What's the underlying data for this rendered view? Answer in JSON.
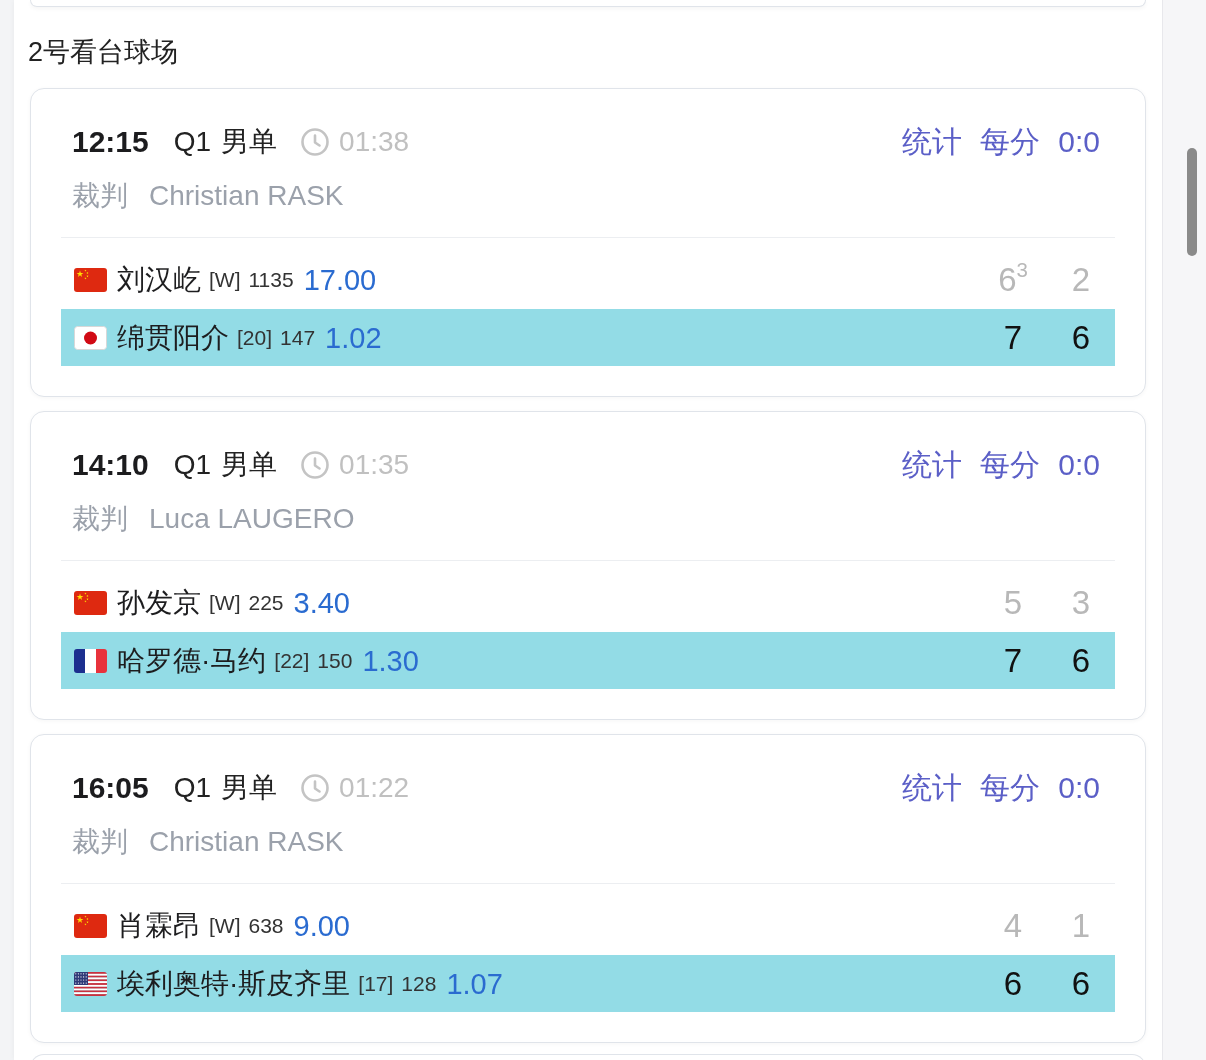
{
  "section": {
    "title": "2号看台球场"
  },
  "matches": [
    {
      "time": "12:15",
      "round": "Q1",
      "event": "男单",
      "duration": "01:38",
      "links": [
        "统计",
        "每分"
      ],
      "point_score": "0:0",
      "umpire_label": "裁判",
      "umpire": "Christian RASK",
      "players": [
        {
          "flag": {
            "kind": "china"
          },
          "name": "刘汉屹",
          "seed": "[W]",
          "rank": "1135",
          "odds": "17.00",
          "sets": [
            "6$^{3}$",
            "2"
          ],
          "winner": false
        },
        {
          "flag": {
            "kind": "japan"
          },
          "name": "绵贯阳介",
          "seed": "[20]",
          "rank": "147",
          "odds": "1.02",
          "sets": [
            "7",
            "6"
          ],
          "winner": true
        }
      ]
    },
    {
      "time": "14:10",
      "round": "Q1",
      "event": "男单",
      "duration": "01:35",
      "links": [
        "统计",
        "每分"
      ],
      "point_score": "0:0",
      "umpire_label": "裁判",
      "umpire": "Luca LAUGERO",
      "players": [
        {
          "flag": {
            "kind": "china"
          },
          "name": "孙发京",
          "seed": "[W]",
          "rank": "225",
          "odds": "3.40",
          "sets": [
            "5",
            "3"
          ],
          "winner": false
        },
        {
          "flag": {
            "kind": "france"
          },
          "name": "哈罗德·马约",
          "seed": "[22]",
          "rank": "150",
          "odds": "1.30",
          "sets": [
            "7",
            "6"
          ],
          "winner": true
        }
      ]
    },
    {
      "time": "16:05",
      "round": "Q1",
      "event": "男单",
      "duration": "01:22",
      "links": [
        "统计",
        "每分"
      ],
      "point_score": "0:0",
      "umpire_label": "裁判",
      "umpire": "Christian RASK",
      "players": [
        {
          "flag": {
            "kind": "china"
          },
          "name": "肖霖昂",
          "seed": "[W]",
          "rank": "638",
          "odds": "9.00",
          "sets": [
            "4",
            "1"
          ],
          "winner": false
        },
        {
          "flag": {
            "kind": "usa"
          },
          "name": "埃利奥特·斯皮齐里",
          "seed": "[17]",
          "rank": "128",
          "odds": "1.07",
          "sets": [
            "6",
            "6"
          ],
          "winner": true
        }
      ]
    }
  ]
}
